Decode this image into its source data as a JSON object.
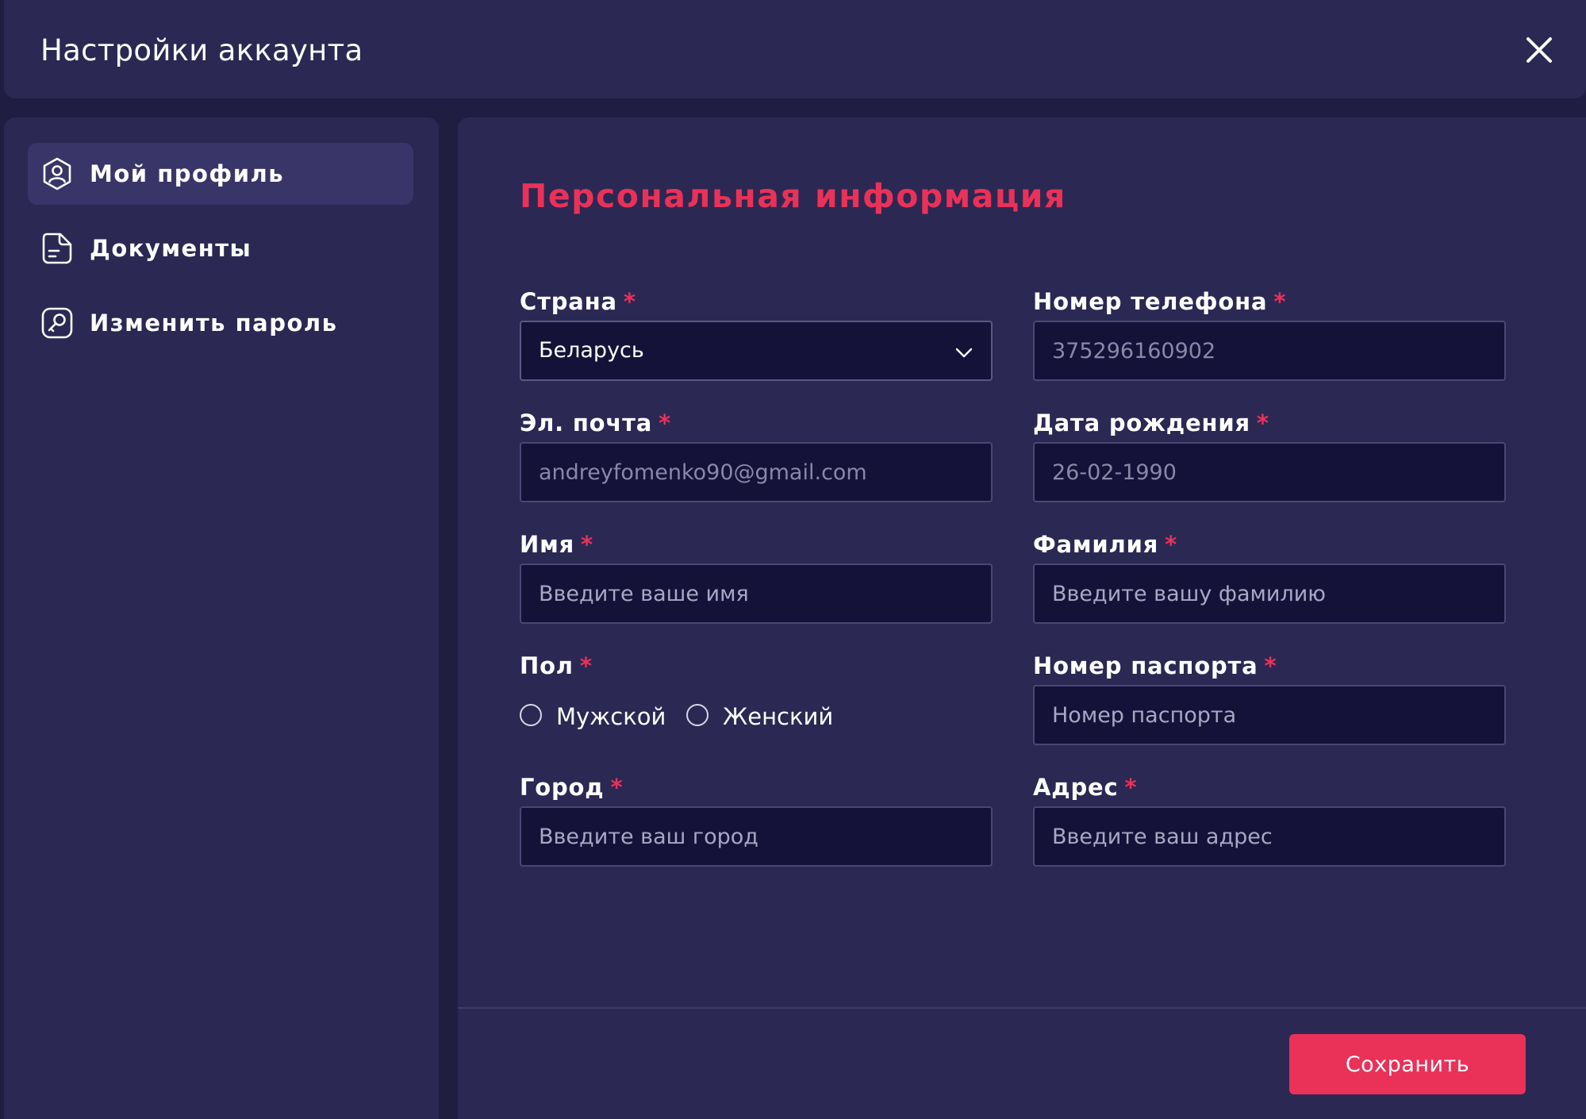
{
  "header": {
    "title": "Настройки аккаунта"
  },
  "sidebar": {
    "items": [
      {
        "label": "Мой профиль",
        "icon": "user-profile-icon",
        "active": true
      },
      {
        "label": "Документы",
        "icon": "document-icon",
        "active": false
      },
      {
        "label": "Изменить пароль",
        "icon": "key-icon",
        "active": false
      }
    ]
  },
  "main": {
    "section_title": "Персональная информация",
    "required_mark": "*",
    "fields": {
      "country": {
        "label": "Страна",
        "value": "Беларусь"
      },
      "phone": {
        "label": "Номер телефона",
        "value": "375296160902"
      },
      "email": {
        "label": "Эл. почта",
        "value": "andreyfomenko90@gmail.com"
      },
      "birthdate": {
        "label": "Дата рождения",
        "value": "26-02-1990"
      },
      "first_name": {
        "label": "Имя",
        "placeholder": "Введите ваше имя"
      },
      "last_name": {
        "label": "Фамилия",
        "placeholder": "Введите вашу фамилию"
      },
      "gender": {
        "label": "Пол",
        "options": [
          "Мужской",
          "Женский"
        ]
      },
      "passport": {
        "label": "Номер паспорта",
        "placeholder": "Номер паспорта"
      },
      "city": {
        "label": "Город",
        "placeholder": "Введите ваш город"
      },
      "address": {
        "label": "Адрес",
        "placeholder": "Введите ваш адрес"
      }
    },
    "save_label": "Сохранить"
  },
  "colors": {
    "background": "#1f1d42",
    "panel": "#2b2854",
    "active_nav": "#3a3568",
    "input_bg": "#15123a",
    "accent": "#ea3158"
  }
}
